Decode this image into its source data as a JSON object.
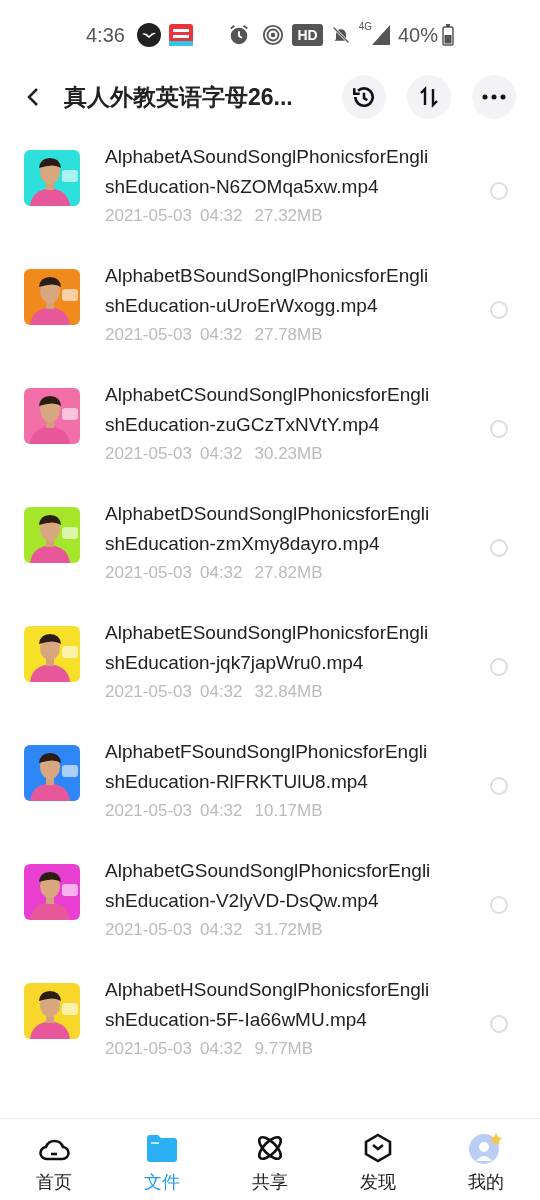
{
  "status_bar": {
    "time": "4:36",
    "hd": "HD",
    "network": "4G",
    "battery": "40%"
  },
  "header": {
    "title": "真人外教英语字母26..."
  },
  "files": [
    {
      "name": "AlphabetASoundSonglPhonicsforEnglishEducation-N6ZOMqa5xw.mp4",
      "date": "2021-05-03",
      "time": "04:32",
      "size": "27.32MB",
      "selected": false
    },
    {
      "name": "AlphabetBSoundSonglPhonicsforEnglishEducation-uUroErWxogg.mp4",
      "date": "2021-05-03",
      "time": "04:32",
      "size": "27.78MB",
      "selected": false
    },
    {
      "name": "AlphabetCSoundSonglPhonicsforEnglishEducation-zuGCzTxNVtY.mp4",
      "date": "2021-05-03",
      "time": "04:32",
      "size": "30.23MB",
      "selected": false
    },
    {
      "name": "AlphabetDSoundSonglPhonicsforEnglishEducation-zmXmy8dayro.mp4",
      "date": "2021-05-03",
      "time": "04:32",
      "size": "27.82MB",
      "selected": false
    },
    {
      "name": "AlphabetESoundSonglPhonicsforEnglishEducation-jqk7japWru0.mp4",
      "date": "2021-05-03",
      "time": "04:32",
      "size": "32.84MB",
      "selected": false
    },
    {
      "name": "AlphabetFSoundSonglPhonicsforEnglishEducation-RlFRKTUlU8.mp4",
      "date": "2021-05-03",
      "time": "04:32",
      "size": "10.17MB",
      "selected": false
    },
    {
      "name": "AlphabetGSoundSonglPhonicsforEnglishEducation-V2lyVD-DsQw.mp4",
      "date": "2021-05-03",
      "time": "04:32",
      "size": "31.72MB",
      "selected": false
    },
    {
      "name": "AlphabetHSoundSonglPhonicsforEnglishEducation-5F-Ia66wMU.mp4",
      "date": "2021-05-03",
      "time": "04:32",
      "size": "9.77MB",
      "selected": false
    }
  ],
  "nav": [
    {
      "kind": "cloud",
      "label": "首页",
      "selected": false
    },
    {
      "kind": "folder",
      "label": "文件",
      "selected": true
    },
    {
      "kind": "atom",
      "label": "共享",
      "selected": false
    },
    {
      "kind": "cube",
      "label": "发现",
      "selected": false
    },
    {
      "kind": "avatar",
      "label": "我的",
      "selected": false
    }
  ]
}
